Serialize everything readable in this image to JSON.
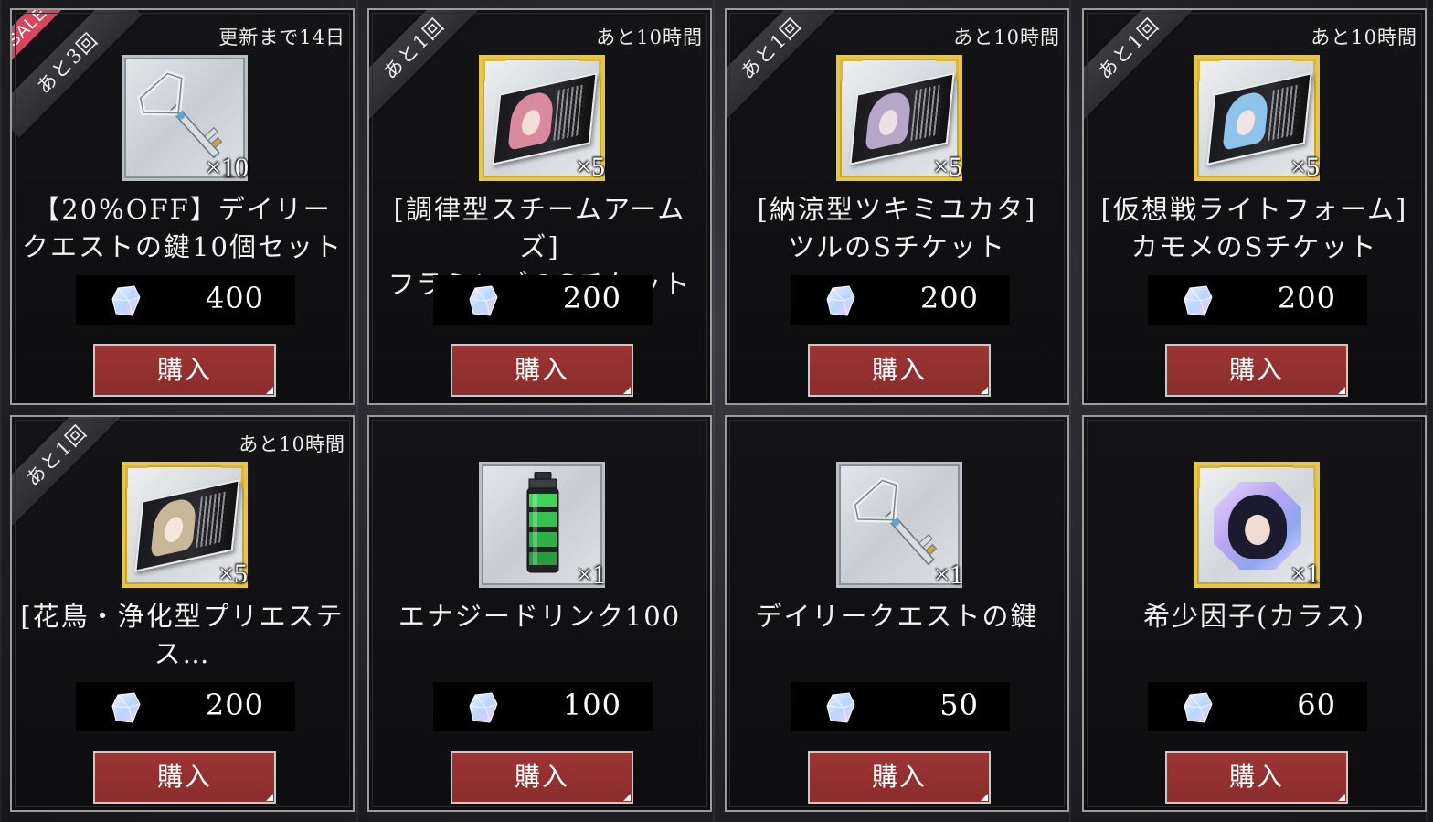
{
  "currency_icon": "gem-crystal-icon",
  "buy_label": "購入",
  "colors": {
    "buy_button": "#9c3534",
    "sale_tag": "#d9445e",
    "gold_frame": "#e6c64a",
    "silver_frame": "#b9c0c6",
    "card_bg": "#141416"
  },
  "items": [
    {
      "remaining": "あと3回",
      "sale_label": "SALE",
      "timer": "更新まで14日",
      "icon": "silver-key-icon",
      "frame": "silver",
      "quantity": "×10",
      "title_line1": "【20%OFF】デイリー",
      "title_line2": "クエストの鍵10個セット",
      "price": "400"
    },
    {
      "remaining": "あと1回",
      "timer": "あと10時間",
      "icon": "s-ticket-flamingo-icon",
      "frame": "gold",
      "quantity": "×5",
      "title_line1": "[調律型スチームアームズ]",
      "title_line2": "フラミンゴのSチケット",
      "price": "200"
    },
    {
      "remaining": "あと1回",
      "timer": "あと10時間",
      "icon": "s-ticket-tsuru-icon",
      "frame": "gold",
      "quantity": "×5",
      "title_line1": "[納涼型ツキミユカタ]",
      "title_line2": "ツルのSチケット",
      "price": "200"
    },
    {
      "remaining": "あと1回",
      "timer": "あと10時間",
      "icon": "s-ticket-kamome-icon",
      "frame": "gold",
      "quantity": "×5",
      "title_line1": "[仮想戦ライトフォーム]",
      "title_line2": "カモメのSチケット",
      "price": "200"
    },
    {
      "remaining": "あと1回",
      "timer": "あと10時間",
      "icon": "s-ticket-priestess-icon",
      "frame": "gold",
      "quantity": "×5",
      "title_line1": "[花鳥・浄化型プリエステ",
      "title_line2": "ス…",
      "price": "200"
    },
    {
      "icon": "energy-drink-icon",
      "frame": "silver",
      "quantity": "×1",
      "title_line1": "エナジードリンク100",
      "title_line2": "",
      "price": "100"
    },
    {
      "icon": "silver-key-icon",
      "frame": "silver",
      "quantity": "×1",
      "title_line1": "デイリークエストの鍵",
      "title_line2": "",
      "price": "50"
    },
    {
      "icon": "rare-factor-crystal-icon",
      "frame": "gold",
      "quantity": "×1",
      "title_line1": "希少因子(カラス)",
      "title_line2": "",
      "price": "60"
    }
  ]
}
